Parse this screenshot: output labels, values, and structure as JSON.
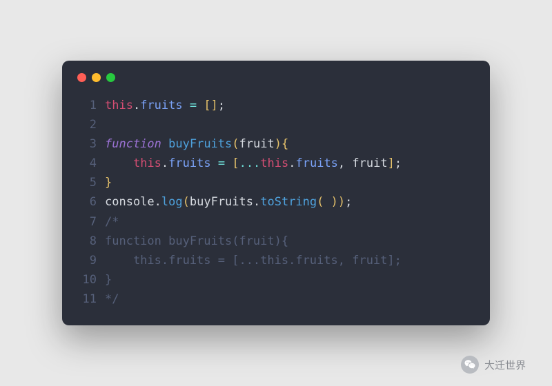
{
  "window": {
    "dots": [
      "close",
      "minimize",
      "zoom"
    ]
  },
  "code": {
    "lines": [
      {
        "n": "1",
        "tokens": [
          {
            "t": "this",
            "c": "this"
          },
          {
            "t": ".",
            "c": "punct"
          },
          {
            "t": "fruits",
            "c": "prop"
          },
          {
            "t": " ",
            "c": ""
          },
          {
            "t": "=",
            "c": "op"
          },
          {
            "t": " ",
            "c": ""
          },
          {
            "t": "[",
            "c": "paren"
          },
          {
            "t": "]",
            "c": "paren"
          },
          {
            "t": ";",
            "c": "punct"
          }
        ]
      },
      {
        "n": "2",
        "tokens": []
      },
      {
        "n": "3",
        "tokens": [
          {
            "t": "function",
            "c": "kw"
          },
          {
            "t": " ",
            "c": ""
          },
          {
            "t": "buyFruits",
            "c": "fn"
          },
          {
            "t": "(",
            "c": "paren"
          },
          {
            "t": "fruit",
            "c": "param"
          },
          {
            "t": ")",
            "c": "paren"
          },
          {
            "t": "{",
            "c": "paren"
          }
        ]
      },
      {
        "n": "4",
        "tokens": [
          {
            "t": "    ",
            "c": ""
          },
          {
            "t": "this",
            "c": "this"
          },
          {
            "t": ".",
            "c": "punct"
          },
          {
            "t": "fruits",
            "c": "prop"
          },
          {
            "t": " ",
            "c": ""
          },
          {
            "t": "=",
            "c": "op"
          },
          {
            "t": " ",
            "c": ""
          },
          {
            "t": "[",
            "c": "paren"
          },
          {
            "t": "...",
            "c": "spread"
          },
          {
            "t": "this",
            "c": "this"
          },
          {
            "t": ".",
            "c": "punct"
          },
          {
            "t": "fruits",
            "c": "prop"
          },
          {
            "t": ",",
            "c": "punct"
          },
          {
            "t": " ",
            "c": ""
          },
          {
            "t": "fruit",
            "c": "param"
          },
          {
            "t": "]",
            "c": "paren"
          },
          {
            "t": ";",
            "c": "punct"
          }
        ]
      },
      {
        "n": "5",
        "tokens": [
          {
            "t": "}",
            "c": "paren"
          }
        ]
      },
      {
        "n": "6",
        "tokens": [
          {
            "t": "console",
            "c": "param"
          },
          {
            "t": ".",
            "c": "punct"
          },
          {
            "t": "log",
            "c": "fn"
          },
          {
            "t": "(",
            "c": "paren"
          },
          {
            "t": "buyFruits",
            "c": "param"
          },
          {
            "t": ".",
            "c": "punct"
          },
          {
            "t": "toString",
            "c": "fn"
          },
          {
            "t": "( )",
            "c": "paren"
          },
          {
            "t": ")",
            "c": "paren"
          },
          {
            "t": ";",
            "c": "punct"
          }
        ]
      },
      {
        "n": "7",
        "tokens": [
          {
            "t": "/*",
            "c": "comment"
          }
        ]
      },
      {
        "n": "8",
        "tokens": [
          {
            "t": "function buyFruits(fruit){",
            "c": "comment"
          }
        ]
      },
      {
        "n": "9",
        "tokens": [
          {
            "t": "    this.fruits = [...this.fruits, fruit];",
            "c": "comment"
          }
        ]
      },
      {
        "n": "10",
        "tokens": [
          {
            "t": "}",
            "c": "comment"
          }
        ]
      },
      {
        "n": "11",
        "tokens": [
          {
            "t": "*/",
            "c": "comment"
          }
        ]
      }
    ]
  },
  "watermark": {
    "text": "大迁世界",
    "icon": "wechat"
  }
}
